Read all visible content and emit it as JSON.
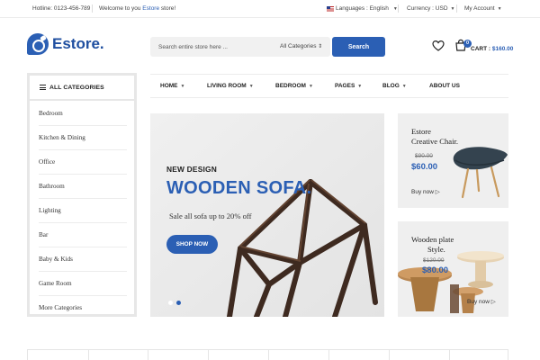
{
  "topbar": {
    "hotline": "Hotline: 0123-456-789",
    "welcome_prefix": "Welcome to you ",
    "welcome_store": "Estore",
    "welcome_suffix": " store!",
    "languages": "Languages : English",
    "currency": "Currency : USD",
    "account": "My Account"
  },
  "header": {
    "logo": "Estore.",
    "search_placeholder": "Search entire store here ...",
    "category_select": "All Categories",
    "search_button": "Search",
    "cart_count": "0",
    "cart_label": "CART : ",
    "cart_amount": "$160.00"
  },
  "categories": {
    "title": "ALL CATEGORIES",
    "items": [
      "Bedroom",
      "Kitchen & Dining",
      "Office",
      "Bathroom",
      "Lighting",
      "Bar",
      "Baby & Kids",
      "Game Room",
      "More Categories"
    ]
  },
  "nav": {
    "items": [
      "HOME",
      "LIVING ROOM",
      "BEDROOM",
      "PAGES",
      "BLOG",
      "ABOUT US"
    ]
  },
  "hero": {
    "subtitle": "NEW DESIGN",
    "title": "WOODEN SOFA.",
    "description": "Sale all sofa up to 20% off",
    "button": "SHOP NOW",
    "active_slide": 2,
    "slide_count": 2
  },
  "banners": [
    {
      "title_line1": "Estore",
      "title_line2": "Creative Chair.",
      "old_price": "$90.00",
      "new_price": "$60.00",
      "cta": "Buy now"
    },
    {
      "title_line1": "Wooden plate",
      "title_line2": "Style.",
      "old_price": "$120.00",
      "new_price": "$80.00",
      "cta": "Buy now"
    }
  ],
  "colors": {
    "accent": "#2b5fb4",
    "panel": "#efefef"
  }
}
